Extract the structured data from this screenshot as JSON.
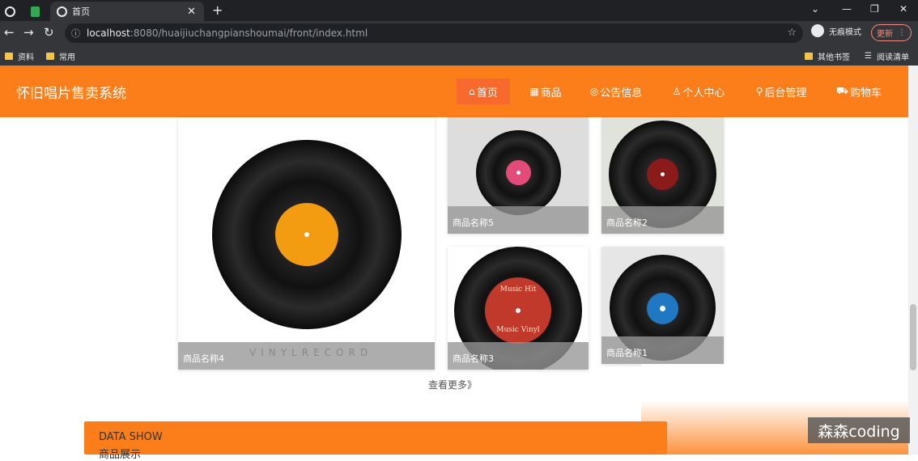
{
  "browser": {
    "tab_title": "首页",
    "url_host": "localhost",
    "url_path": ":8080/huaijiuchangpianshoumai/front/index.html",
    "incognito_label": "无痕模式",
    "update_label": "更新",
    "bookmarks": [
      "资料",
      "常用"
    ],
    "bookmarks_right": [
      "其他书签",
      "阅读清单"
    ]
  },
  "site": {
    "title": "怀旧唱片售卖系统",
    "menu": [
      {
        "icon": "home-icon",
        "label": "首页",
        "active": true
      },
      {
        "icon": "goods-icon",
        "label": "商品"
      },
      {
        "icon": "notice-icon",
        "label": "公告信息"
      },
      {
        "icon": "user-icon",
        "label": "个人中心"
      },
      {
        "icon": "admin-icon",
        "label": "后台管理"
      },
      {
        "icon": "cart-icon",
        "label": "购物车"
      }
    ],
    "products": [
      {
        "name": "商品名称4",
        "label_color": "#f39c12"
      },
      {
        "name": "商品名称5",
        "label_color": "#e24b7a"
      },
      {
        "name": "商品名称2",
        "label_color": "#8b1a1a"
      },
      {
        "name": "商品名称3",
        "label_color": "#c0392b"
      },
      {
        "name": "商品名称1",
        "label_color": "#1f78c1"
      }
    ],
    "vinyl_text": "VINYLRECORD",
    "record_label_top": "Music Hit",
    "record_label_bottom": "Music Vinyl",
    "more_label": "查看更多》",
    "datashow_en": "DATA SHOW",
    "datashow_cn": "商品展示"
  },
  "watermark": "森森coding",
  "colors": {
    "accent": "#fb7e1a",
    "active": "#f7692c"
  }
}
